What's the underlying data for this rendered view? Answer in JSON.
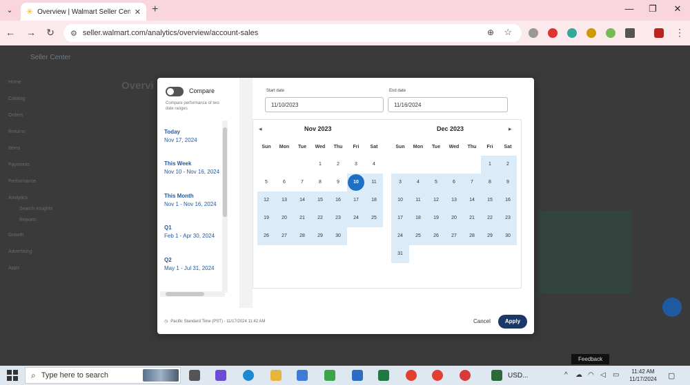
{
  "browser": {
    "tab_title": "Overview | Walmart Seller Centr",
    "url": "seller.walmart.com/analytics/overview/account-sales"
  },
  "page": {
    "brand": "Seller Center",
    "title": "Overvi",
    "sidebar": [
      "Home",
      "Catalog",
      "Orders",
      "Returns",
      "Items",
      "Payments",
      "Performance",
      "Analytics",
      "Search Insights",
      "Reports",
      "Growth",
      "Advertising",
      "Apps"
    ],
    "feedback": "Feedback"
  },
  "modal": {
    "compare_label": "Compare",
    "compare_desc": "Compare performance of two date ranges",
    "presets": [
      {
        "title": "Today",
        "dates": "Nov 17, 2024"
      },
      {
        "title": "This Week",
        "dates": "Nov 10 - Nov 16, 2024"
      },
      {
        "title": "This Month",
        "dates": "Nov 1 - Nov 16, 2024"
      },
      {
        "title": "Q1",
        "dates": "Feb 1 - Apr 30, 2024"
      },
      {
        "title": "Q2",
        "dates": "May 1 - Jul 31, 2024"
      }
    ],
    "start_label": "Start date",
    "start_value": "11/10/2023",
    "end_label": "End date",
    "end_value": "11/16/2024",
    "left_month": "Nov 2023",
    "right_month": "Dec 2023",
    "weekdays": [
      "Sun",
      "Mon",
      "Tue",
      "Wed",
      "Thu",
      "Fri",
      "Sat"
    ],
    "timezone": "Pacific Standard Time (PST) - 11/17/2024 11:42 AM",
    "cancel_label": "Cancel",
    "apply_label": "Apply"
  },
  "taskbar": {
    "search_placeholder": "Type here to search",
    "currency": "USD...",
    "time": "11:42 AM",
    "date": "11/17/2024"
  },
  "colors": {
    "accent": "#1f6fc4",
    "range": "#dcebf8",
    "apply": "#1a3768"
  }
}
